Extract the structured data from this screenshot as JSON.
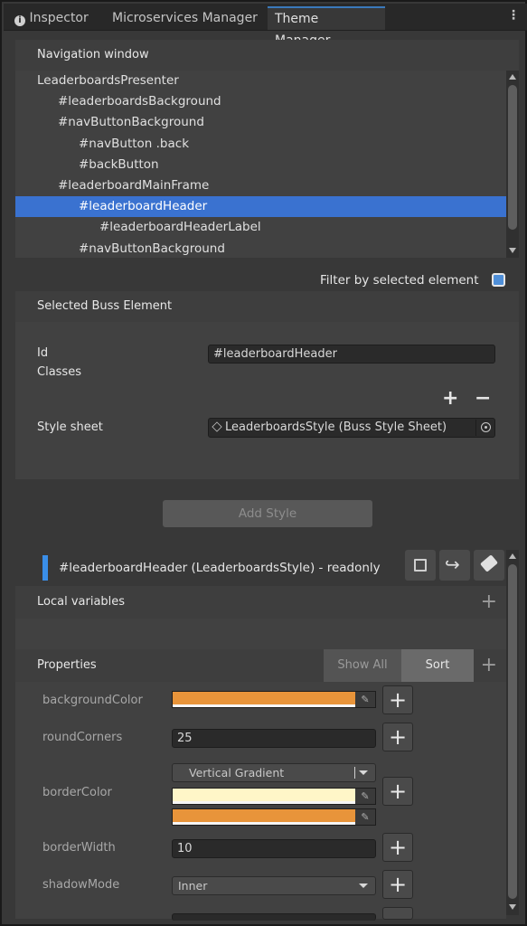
{
  "tabs": [
    {
      "label": "Inspector",
      "icon": "info-icon"
    },
    {
      "label": "Microservices Manager"
    },
    {
      "label": "Theme Manager"
    }
  ],
  "tabs_menu": "⋮",
  "navigation": {
    "title": "Navigation window",
    "items": [
      {
        "label": "LeaderboardsPresenter",
        "indent": 0
      },
      {
        "label": "#leaderboardsBackground",
        "indent": 1
      },
      {
        "label": "#navButtonBackground",
        "indent": 1
      },
      {
        "label": "#navButton .back",
        "indent": 2
      },
      {
        "label": "#backButton",
        "indent": 2
      },
      {
        "label": "#leaderboardMainFrame",
        "indent": 1
      },
      {
        "label": "#leaderboardHeader",
        "indent": 2,
        "selected": true
      },
      {
        "label": "#leaderboardHeaderLabel",
        "indent": 3
      },
      {
        "label": "#navButtonBackground",
        "indent": 2
      }
    ],
    "filter_label": "Filter by selected element",
    "filter_checked": true
  },
  "selected": {
    "title": "Selected Buss Element",
    "id_label": "Id",
    "id_value": "#leaderboardHeader",
    "classes_label": "Classes",
    "plus": "+",
    "minus": "−",
    "stylesheet_label": "Style sheet",
    "stylesheet_value": "LeaderboardsStyle (Buss Style Sheet)"
  },
  "add_style_label": "Add Style",
  "style_card": {
    "title": "#leaderboardHeader (LeaderboardsStyle) - readonly",
    "local_variables_label": "Local variables",
    "properties_label": "Properties",
    "show_all_label": "Show All",
    "sort_label": "Sort",
    "plus": "+"
  },
  "properties": [
    {
      "name": "backgroundColor",
      "kind": "color",
      "color": "#E8943A"
    },
    {
      "name": "roundCorners",
      "kind": "number",
      "value": "25"
    },
    {
      "name": "borderColor",
      "kind": "gradient",
      "mode": "Vertical Gradient",
      "colors": [
        "#FFF6C8",
        "#E8943A"
      ]
    },
    {
      "name": "borderWidth",
      "kind": "number",
      "value": "10"
    },
    {
      "name": "shadowMode",
      "kind": "enum",
      "value": "Inner"
    }
  ],
  "colors": {
    "accent": "#3a72d0",
    "card_bar": "#3a8ee8"
  }
}
